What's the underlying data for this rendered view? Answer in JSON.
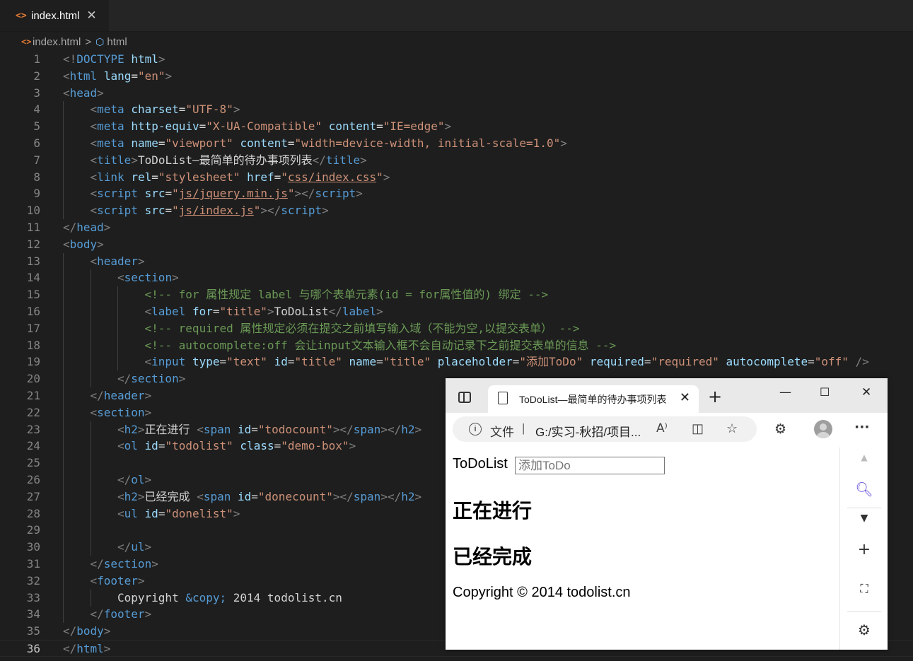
{
  "editor": {
    "tab": {
      "label": "index.html",
      "icon": "html-file-icon",
      "close": "✕"
    },
    "breadcrumb": {
      "file": "index.html",
      "separator": ">",
      "symbol": "html"
    },
    "current_line": 36,
    "lines": [
      {
        "n": "1",
        "indent": 0,
        "t": [
          [
            "br",
            "<!"
          ],
          [
            "tag",
            "DOCTYPE"
          ],
          [
            "plain",
            " "
          ],
          [
            "attr",
            "html"
          ],
          [
            "br",
            ">"
          ]
        ]
      },
      {
        "n": "2",
        "indent": 0,
        "t": [
          [
            "br",
            "<"
          ],
          [
            "tag",
            "html"
          ],
          [
            "plain",
            " "
          ],
          [
            "attr",
            "lang"
          ],
          [
            "plain",
            "="
          ],
          [
            "str",
            "\"en\""
          ],
          [
            "br",
            ">"
          ]
        ]
      },
      {
        "n": "3",
        "indent": 0,
        "t": [
          [
            "br",
            "<"
          ],
          [
            "tag",
            "head"
          ],
          [
            "br",
            ">"
          ]
        ]
      },
      {
        "n": "4",
        "indent": 1,
        "t": [
          [
            "br",
            "<"
          ],
          [
            "tag",
            "meta"
          ],
          [
            "plain",
            " "
          ],
          [
            "attr",
            "charset"
          ],
          [
            "plain",
            "="
          ],
          [
            "str",
            "\"UTF-8\""
          ],
          [
            "br",
            ">"
          ]
        ]
      },
      {
        "n": "5",
        "indent": 1,
        "t": [
          [
            "br",
            "<"
          ],
          [
            "tag",
            "meta"
          ],
          [
            "plain",
            " "
          ],
          [
            "attr",
            "http-equiv"
          ],
          [
            "plain",
            "="
          ],
          [
            "str",
            "\"X-UA-Compatible\""
          ],
          [
            "plain",
            " "
          ],
          [
            "attr",
            "content"
          ],
          [
            "plain",
            "="
          ],
          [
            "str",
            "\"IE=edge\""
          ],
          [
            "br",
            ">"
          ]
        ]
      },
      {
        "n": "6",
        "indent": 1,
        "t": [
          [
            "br",
            "<"
          ],
          [
            "tag",
            "meta"
          ],
          [
            "plain",
            " "
          ],
          [
            "attr",
            "name"
          ],
          [
            "plain",
            "="
          ],
          [
            "str",
            "\"viewport\""
          ],
          [
            "plain",
            " "
          ],
          [
            "attr",
            "content"
          ],
          [
            "plain",
            "="
          ],
          [
            "str",
            "\"width=device-width, initial-scale=1.0\""
          ],
          [
            "br",
            ">"
          ]
        ]
      },
      {
        "n": "7",
        "indent": 1,
        "t": [
          [
            "br",
            "<"
          ],
          [
            "tag",
            "title"
          ],
          [
            "br",
            ">"
          ],
          [
            "plain",
            "ToDoList—最简单的待办事项列表"
          ],
          [
            "br",
            "</"
          ],
          [
            "tag",
            "title"
          ],
          [
            "br",
            ">"
          ]
        ]
      },
      {
        "n": "8",
        "indent": 1,
        "t": [
          [
            "br",
            "<"
          ],
          [
            "tag",
            "link"
          ],
          [
            "plain",
            " "
          ],
          [
            "attr",
            "rel"
          ],
          [
            "plain",
            "="
          ],
          [
            "str",
            "\"stylesheet\""
          ],
          [
            "plain",
            " "
          ],
          [
            "attr",
            "href"
          ],
          [
            "plain",
            "="
          ],
          [
            "str",
            "\""
          ],
          [
            "strlink",
            "css/index.css"
          ],
          [
            "str",
            "\""
          ],
          [
            "br",
            ">"
          ]
        ]
      },
      {
        "n": "9",
        "indent": 1,
        "t": [
          [
            "br",
            "<"
          ],
          [
            "tag",
            "script"
          ],
          [
            "plain",
            " "
          ],
          [
            "attr",
            "src"
          ],
          [
            "plain",
            "="
          ],
          [
            "str",
            "\""
          ],
          [
            "strlink",
            "js/jquery.min.js"
          ],
          [
            "str",
            "\""
          ],
          [
            "br",
            "></"
          ],
          [
            "tag",
            "script"
          ],
          [
            "br",
            ">"
          ]
        ]
      },
      {
        "n": "10",
        "indent": 1,
        "t": [
          [
            "br",
            "<"
          ],
          [
            "tag",
            "script"
          ],
          [
            "plain",
            " "
          ],
          [
            "attr",
            "src"
          ],
          [
            "plain",
            "="
          ],
          [
            "str",
            "\""
          ],
          [
            "strlink",
            "js/index.js"
          ],
          [
            "str",
            "\""
          ],
          [
            "br",
            "></"
          ],
          [
            "tag",
            "script"
          ],
          [
            "br",
            ">"
          ]
        ]
      },
      {
        "n": "11",
        "indent": 0,
        "t": [
          [
            "br",
            "</"
          ],
          [
            "tag",
            "head"
          ],
          [
            "br",
            ">"
          ]
        ]
      },
      {
        "n": "12",
        "indent": 0,
        "t": [
          [
            "br",
            "<"
          ],
          [
            "tag",
            "body"
          ],
          [
            "br",
            ">"
          ]
        ]
      },
      {
        "n": "13",
        "indent": 1,
        "t": [
          [
            "br",
            "<"
          ],
          [
            "tag",
            "header"
          ],
          [
            "br",
            ">"
          ]
        ]
      },
      {
        "n": "14",
        "indent": 2,
        "t": [
          [
            "br",
            "<"
          ],
          [
            "tag",
            "section"
          ],
          [
            "br",
            ">"
          ]
        ]
      },
      {
        "n": "15",
        "indent": 3,
        "t": [
          [
            "com",
            "<!-- for 属性规定 label 与哪个表单元素(id = for属性值的) 绑定 -->"
          ]
        ]
      },
      {
        "n": "16",
        "indent": 3,
        "t": [
          [
            "br",
            "<"
          ],
          [
            "tag",
            "label"
          ],
          [
            "plain",
            " "
          ],
          [
            "attr",
            "for"
          ],
          [
            "plain",
            "="
          ],
          [
            "str",
            "\"title\""
          ],
          [
            "br",
            ">"
          ],
          [
            "plain",
            "ToDoList"
          ],
          [
            "br",
            "</"
          ],
          [
            "tag",
            "label"
          ],
          [
            "br",
            ">"
          ]
        ]
      },
      {
        "n": "17",
        "indent": 3,
        "t": [
          [
            "com",
            "<!-- required 属性规定必须在提交之前填写输入域（不能为空,以提交表单） -->"
          ]
        ]
      },
      {
        "n": "18",
        "indent": 3,
        "t": [
          [
            "com",
            "<!-- autocomplete:off 会让input文本输入框不会自动记录下之前提交表单的信息 -->"
          ]
        ]
      },
      {
        "n": "19",
        "indent": 3,
        "t": [
          [
            "br",
            "<"
          ],
          [
            "tag",
            "input"
          ],
          [
            "plain",
            " "
          ],
          [
            "attr",
            "type"
          ],
          [
            "plain",
            "="
          ],
          [
            "str",
            "\"text\""
          ],
          [
            "plain",
            " "
          ],
          [
            "attr",
            "id"
          ],
          [
            "plain",
            "="
          ],
          [
            "str",
            "\"title\""
          ],
          [
            "plain",
            " "
          ],
          [
            "attr",
            "name"
          ],
          [
            "plain",
            "="
          ],
          [
            "str",
            "\"title\""
          ],
          [
            "plain",
            " "
          ],
          [
            "attr",
            "placeholder"
          ],
          [
            "plain",
            "="
          ],
          [
            "str",
            "\"添加ToDo\""
          ],
          [
            "plain",
            " "
          ],
          [
            "attr",
            "required"
          ],
          [
            "plain",
            "="
          ],
          [
            "str",
            "\"required\""
          ],
          [
            "plain",
            " "
          ],
          [
            "attr",
            "autocomplete"
          ],
          [
            "plain",
            "="
          ],
          [
            "str",
            "\"off\""
          ],
          [
            "plain",
            " "
          ],
          [
            "br",
            "/>"
          ]
        ]
      },
      {
        "n": "20",
        "indent": 2,
        "t": [
          [
            "br",
            "</"
          ],
          [
            "tag",
            "section"
          ],
          [
            "br",
            ">"
          ]
        ]
      },
      {
        "n": "21",
        "indent": 1,
        "t": [
          [
            "br",
            "</"
          ],
          [
            "tag",
            "header"
          ],
          [
            "br",
            ">"
          ]
        ]
      },
      {
        "n": "22",
        "indent": 1,
        "t": [
          [
            "br",
            "<"
          ],
          [
            "tag",
            "section"
          ],
          [
            "br",
            ">"
          ]
        ]
      },
      {
        "n": "23",
        "indent": 2,
        "t": [
          [
            "br",
            "<"
          ],
          [
            "tag",
            "h2"
          ],
          [
            "br",
            ">"
          ],
          [
            "plain",
            "正在进行 "
          ],
          [
            "br",
            "<"
          ],
          [
            "tag",
            "span"
          ],
          [
            "plain",
            " "
          ],
          [
            "attr",
            "id"
          ],
          [
            "plain",
            "="
          ],
          [
            "str",
            "\"todocount\""
          ],
          [
            "br",
            "></"
          ],
          [
            "tag",
            "span"
          ],
          [
            "br",
            "></"
          ],
          [
            "tag",
            "h2"
          ],
          [
            "br",
            ">"
          ]
        ]
      },
      {
        "n": "24",
        "indent": 2,
        "t": [
          [
            "br",
            "<"
          ],
          [
            "tag",
            "ol"
          ],
          [
            "plain",
            " "
          ],
          [
            "attr",
            "id"
          ],
          [
            "plain",
            "="
          ],
          [
            "str",
            "\"todolist\""
          ],
          [
            "plain",
            " "
          ],
          [
            "attr",
            "class"
          ],
          [
            "plain",
            "="
          ],
          [
            "str",
            "\"demo-box\""
          ],
          [
            "br",
            ">"
          ]
        ]
      },
      {
        "n": "25",
        "indent": 2,
        "t": []
      },
      {
        "n": "26",
        "indent": 2,
        "t": [
          [
            "br",
            "</"
          ],
          [
            "tag",
            "ol"
          ],
          [
            "br",
            ">"
          ]
        ]
      },
      {
        "n": "27",
        "indent": 2,
        "t": [
          [
            "br",
            "<"
          ],
          [
            "tag",
            "h2"
          ],
          [
            "br",
            ">"
          ],
          [
            "plain",
            "已经完成 "
          ],
          [
            "br",
            "<"
          ],
          [
            "tag",
            "span"
          ],
          [
            "plain",
            " "
          ],
          [
            "attr",
            "id"
          ],
          [
            "plain",
            "="
          ],
          [
            "str",
            "\"donecount\""
          ],
          [
            "br",
            "></"
          ],
          [
            "tag",
            "span"
          ],
          [
            "br",
            "></"
          ],
          [
            "tag",
            "h2"
          ],
          [
            "br",
            ">"
          ]
        ]
      },
      {
        "n": "28",
        "indent": 2,
        "t": [
          [
            "br",
            "<"
          ],
          [
            "tag",
            "ul"
          ],
          [
            "plain",
            " "
          ],
          [
            "attr",
            "id"
          ],
          [
            "plain",
            "="
          ],
          [
            "str",
            "\"donelist\""
          ],
          [
            "br",
            ">"
          ]
        ]
      },
      {
        "n": "29",
        "indent": 2,
        "t": []
      },
      {
        "n": "30",
        "indent": 2,
        "t": [
          [
            "br",
            "</"
          ],
          [
            "tag",
            "ul"
          ],
          [
            "br",
            ">"
          ]
        ]
      },
      {
        "n": "31",
        "indent": 1,
        "t": [
          [
            "br",
            "</"
          ],
          [
            "tag",
            "section"
          ],
          [
            "br",
            ">"
          ]
        ]
      },
      {
        "n": "32",
        "indent": 1,
        "t": [
          [
            "br",
            "<"
          ],
          [
            "tag",
            "footer"
          ],
          [
            "br",
            ">"
          ]
        ]
      },
      {
        "n": "33",
        "indent": 2,
        "t": [
          [
            "plain",
            "Copyright "
          ],
          [
            "ent",
            "&copy;"
          ],
          [
            "plain",
            " 2014 todolist.cn"
          ]
        ]
      },
      {
        "n": "34",
        "indent": 1,
        "t": [
          [
            "br",
            "</"
          ],
          [
            "tag",
            "footer"
          ],
          [
            "br",
            ">"
          ]
        ]
      },
      {
        "n": "35",
        "indent": 0,
        "t": [
          [
            "br",
            "</"
          ],
          [
            "tag",
            "body"
          ],
          [
            "br",
            ">"
          ]
        ]
      },
      {
        "n": "36",
        "indent": 0,
        "t": [
          [
            "br",
            "</"
          ],
          [
            "tag",
            "html"
          ],
          [
            "br",
            ">"
          ]
        ]
      }
    ]
  },
  "browser": {
    "tab_title": "ToDoList—最简单的待办事项列表",
    "tab_close": "✕",
    "new_tab": "+",
    "minimize": "—",
    "maximize": "☐",
    "close": "✕",
    "address": {
      "info": "i",
      "scheme_label": "文件",
      "separator": "|",
      "path": "G:/实习-秋招/项目..."
    },
    "icons": [
      "read-aloud-icon",
      "split-screen-icon",
      "favorite-star-icon",
      "extensions-icon",
      "profile-avatar-icon",
      "more-menu-icon"
    ],
    "page": {
      "label": "ToDoList",
      "input_placeholder": "添加ToDo",
      "heading_doing": "正在进行",
      "heading_done": "已经完成",
      "footer": "Copyright © 2014 todolist.cn"
    },
    "sidebar_icons": [
      "scroll-up-icon",
      "search-icon",
      "shopping-icon",
      "add-icon",
      "screenshot-icon",
      "settings-icon"
    ]
  }
}
